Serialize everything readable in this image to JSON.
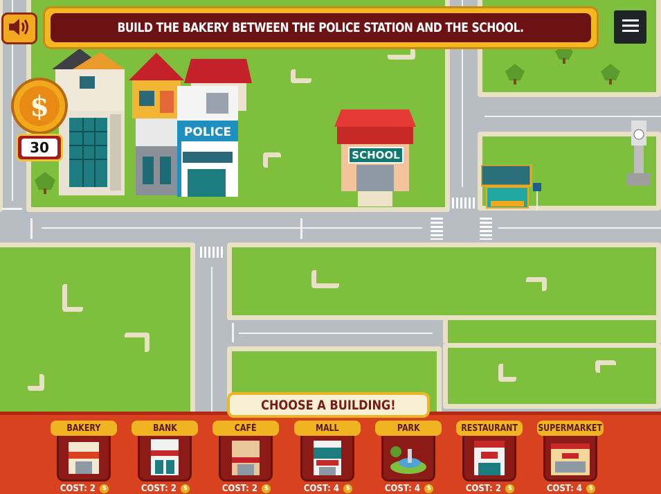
{
  "instruction": "BUILD THE BAKERY BETWEEN THE POLICE STATION AND THE SCHOOL.",
  "coins": "30",
  "icons": {
    "sound": "speaker-icon",
    "menu": "hamburger-menu-icon",
    "coin": "dollar-coin-icon",
    "cost_coin": "$"
  },
  "map_signs": {
    "police": "POLICE",
    "school": "SCHOOL"
  },
  "panel": {
    "title": "CHOOSE A BUILDING!",
    "buildings": [
      {
        "label": "BAKERY",
        "cost": "COST: 2",
        "sign": "BAKERY"
      },
      {
        "label": "BANK",
        "cost": "COST: 2",
        "sign": "BANK"
      },
      {
        "label": "CAFÉ",
        "cost": "COST: 2",
        "sign": "Café"
      },
      {
        "label": "MALL",
        "cost": "COST: 4",
        "sign": "MALL"
      },
      {
        "label": "PARK",
        "cost": "COST: 4",
        "sign": ""
      },
      {
        "label": "RESTAURANT",
        "cost": "COST: 2",
        "sign": "Restaurant"
      },
      {
        "label": "SUPERMARKET",
        "cost": "COST: 4",
        "sign": "Supermarket"
      }
    ]
  },
  "colors": {
    "grass": "#7ec03e",
    "road": "#a6abb5",
    "banner": "#6d1214",
    "panel": "#d8421f"
  }
}
